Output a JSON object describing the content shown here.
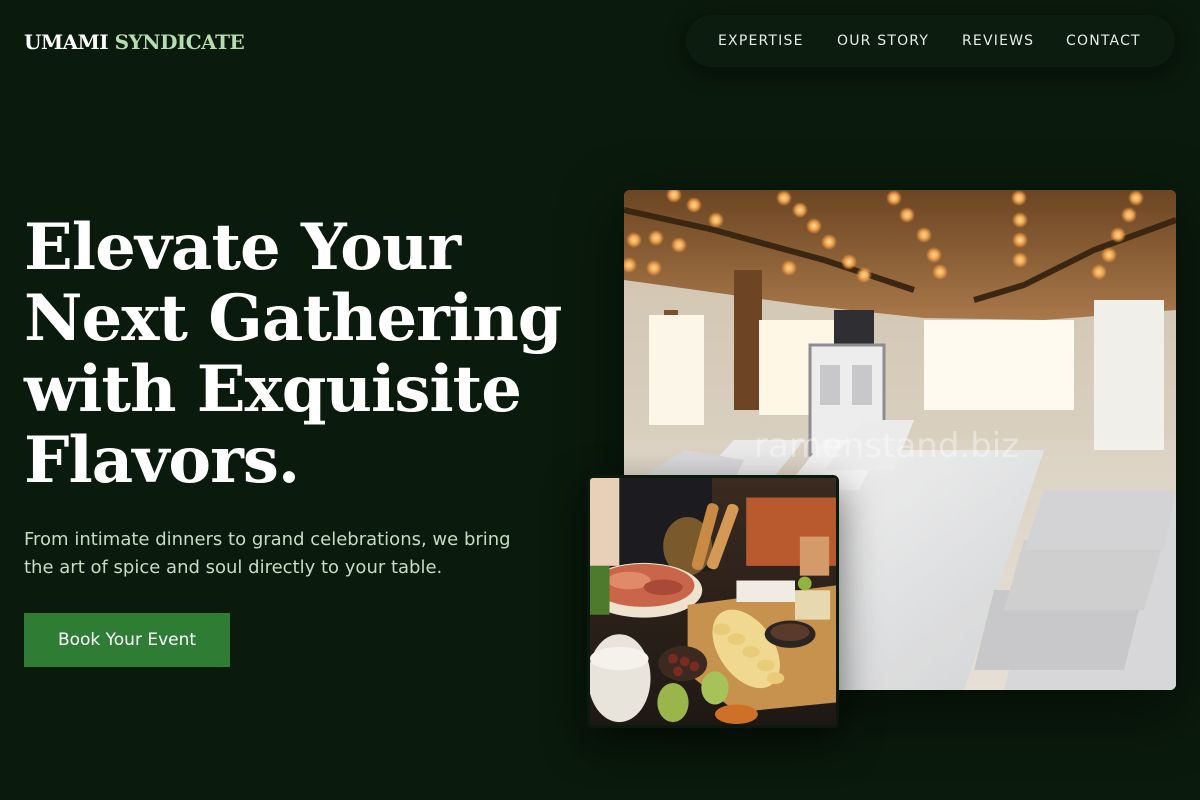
{
  "header": {
    "brand_part1": "UMAMI",
    "brand_part2": "SYNDICATE",
    "nav": [
      {
        "label": "EXPERTISE"
      },
      {
        "label": "OUR STORY"
      },
      {
        "label": "REVIEWS"
      },
      {
        "label": "CONTACT"
      }
    ]
  },
  "hero": {
    "title_lines": [
      "Elevate Your",
      "Next Gathering",
      "with Exquisite",
      "Flavors."
    ],
    "subtitle": "From intimate dinners to grand celebrations, we bring the art of spice and soul directly to your table.",
    "cta_label": "Book Your Event"
  },
  "images": {
    "watermark": "ramenstand.biz"
  },
  "colors": {
    "background": "#0a1a0c",
    "brand_accent": "#b7dcb2",
    "cta": "#2f7d35",
    "subtitle": "#c6dcc4"
  }
}
